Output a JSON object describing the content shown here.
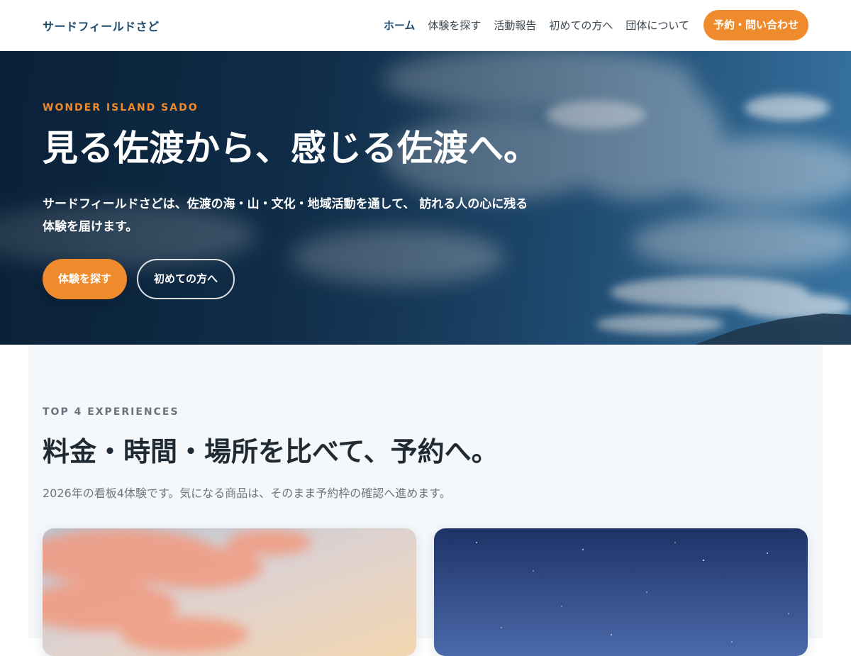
{
  "header": {
    "brand": "サードフィールドさど",
    "nav": [
      {
        "label": "ホーム",
        "active": true
      },
      {
        "label": "体験を探す",
        "active": false
      },
      {
        "label": "活動報告",
        "active": false
      },
      {
        "label": "初めての方へ",
        "active": false
      },
      {
        "label": "団体について",
        "active": false
      }
    ],
    "cta_label": "予約・問い合わせ"
  },
  "hero": {
    "eyebrow": "WONDER ISLAND SADO",
    "title": "見る佐渡から、感じる佐渡へ。",
    "lead": "サードフィールドさどは、佐渡の海・山・文化・地域活動を通して、 訪れる人の心に残る体験を届けます。",
    "primary_button": "体験を探す",
    "secondary_button": "初めての方へ"
  },
  "experiences": {
    "eyebrow": "TOP 4 EXPERIENCES",
    "title": "料金・時間・場所を比べて、予約へ。",
    "description": "2026年の看板4体験です。気になる商品は、そのまま予約枠の確認へ進めます。",
    "cards": [
      {
        "image": "sunset-clouds-photo"
      },
      {
        "image": "starry-night-sky-photo"
      }
    ]
  },
  "colors": {
    "accent": "#ef8b2c",
    "brand": "#1d4a6b",
    "section_bg": "#f5f8fb"
  }
}
